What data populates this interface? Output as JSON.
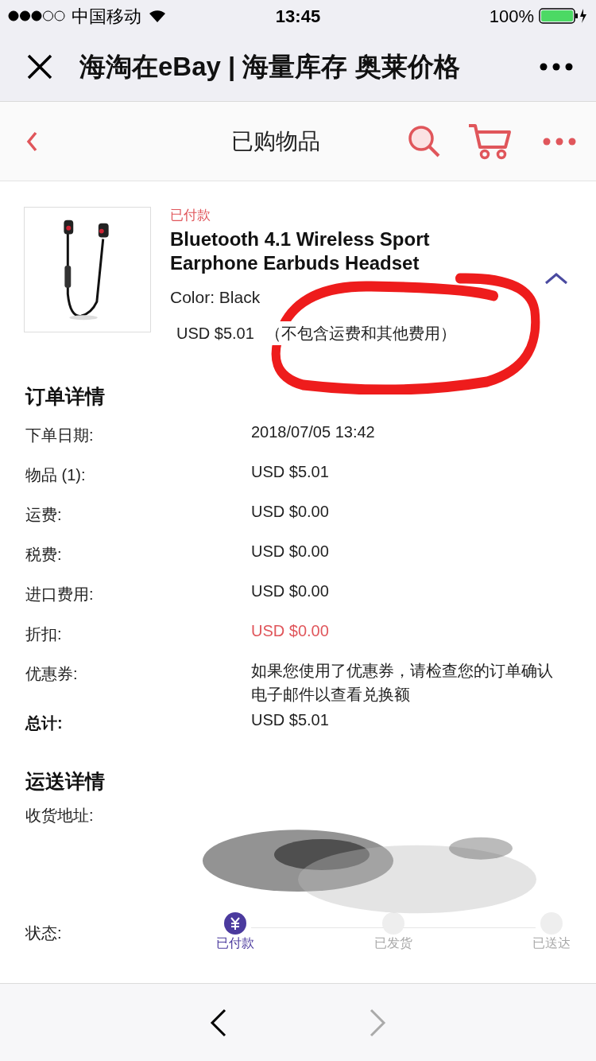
{
  "status_bar": {
    "carrier": "中国移动",
    "time": "13:45",
    "battery": "100%"
  },
  "browser_bar": {
    "title": "海淘在eBay | 海量库存 奥莱价格"
  },
  "header": {
    "title": "已购物品"
  },
  "item": {
    "status": "已付款",
    "title": "Bluetooth 4.1 Wireless Sport Earphone Earbuds Headset",
    "variant": "Color: Black",
    "price": "USD $5.01",
    "price_note": "（不包含运费和其他费用）",
    "expanded": true
  },
  "order_details": {
    "heading": "订单详情",
    "rows": [
      {
        "label": "下单日期:",
        "value": "2018/07/05 13:42",
        "kind": "normal"
      },
      {
        "label": "物品 (1):",
        "value": "USD $5.01",
        "kind": "normal"
      },
      {
        "label": "运费:",
        "value": "USD $0.00",
        "kind": "normal"
      },
      {
        "label": "税费:",
        "value": "USD $0.00",
        "kind": "normal"
      },
      {
        "label": "进口费用:",
        "value": "USD $0.00",
        "kind": "normal"
      },
      {
        "label": "折扣:",
        "value": "USD $0.00",
        "kind": "discount"
      },
      {
        "label": "优惠券:",
        "value": "如果您使用了优惠券，请检查您的订单确认电子邮件以查看兑换额",
        "kind": "normal"
      },
      {
        "label": "总计:",
        "value": "USD $5.01",
        "kind": "total"
      }
    ]
  },
  "shipping": {
    "heading": "运送详情",
    "address_label": "收货地址:",
    "status_label": "状态:",
    "steps": [
      {
        "label": "已付款",
        "selected": true
      },
      {
        "label": "已发货",
        "selected": false
      },
      {
        "label": "已送达",
        "selected": false
      }
    ]
  }
}
